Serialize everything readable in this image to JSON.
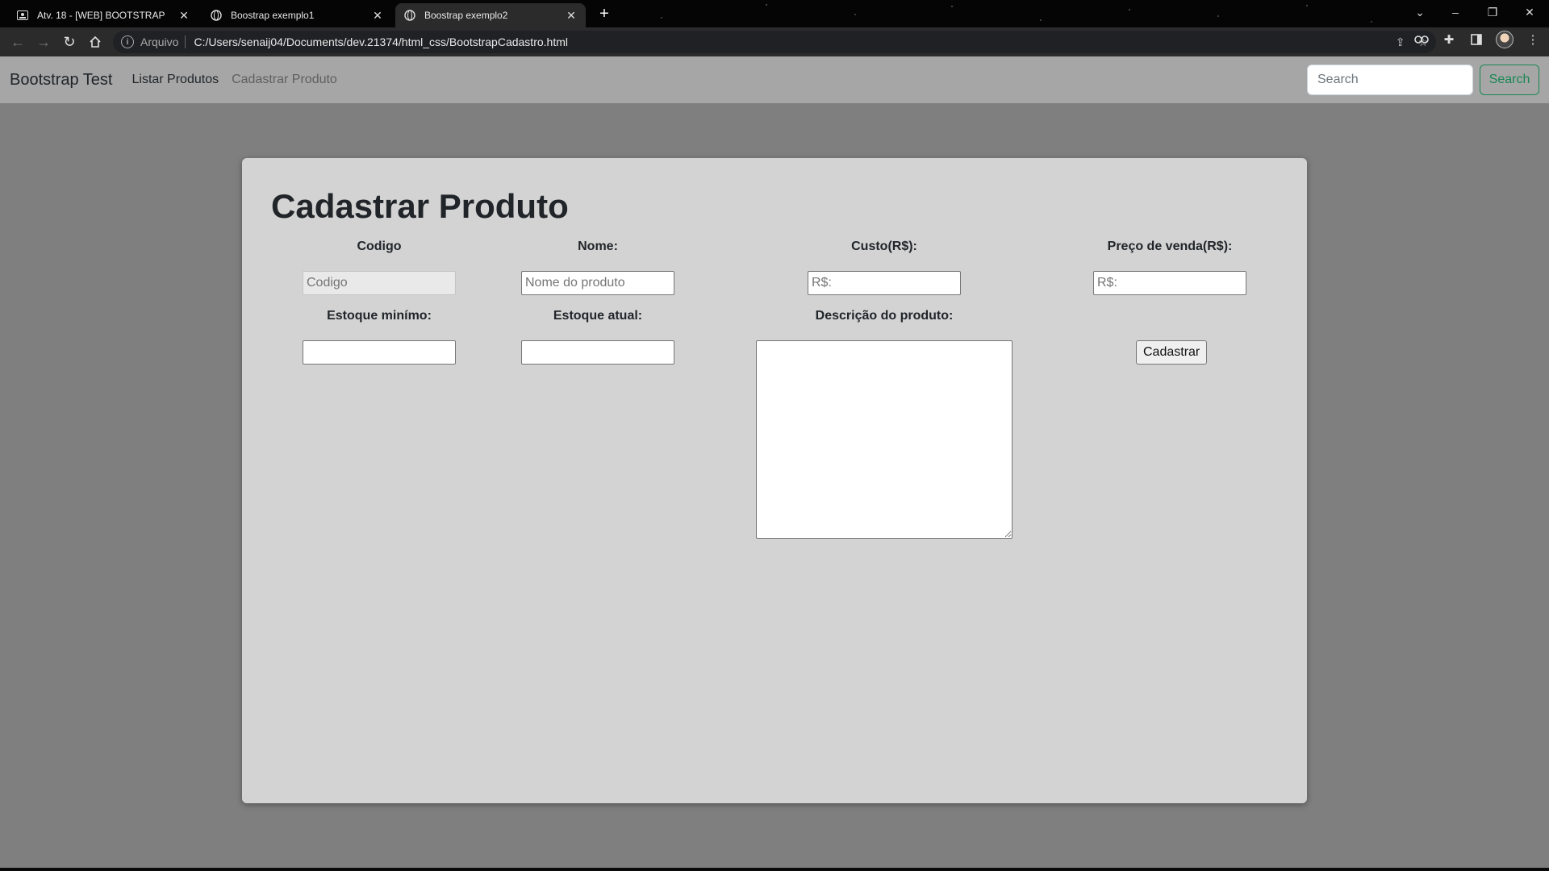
{
  "browser": {
    "tabs": [
      {
        "title": "Atv. 18 - [WEB] BOOTSTRAP",
        "icon": "page-icon",
        "active": false
      },
      {
        "title": "Boostrap exemplo1",
        "icon": "globe-icon",
        "active": false
      },
      {
        "title": "Boostrap exemplo2",
        "icon": "globe-icon",
        "active": true
      }
    ],
    "address": {
      "scheme_label": "Arquivo",
      "url": "C:/Users/senaij04/Documents/dev.21374/html_css/BootstrapCadastro.html"
    }
  },
  "navbar": {
    "brand": "Bootstrap Test",
    "links": [
      "Listar Produtos",
      "Cadastrar Produto"
    ],
    "search_placeholder": "Search",
    "search_button": "Search",
    "accent_color": "#198754"
  },
  "form": {
    "title": "Cadastrar Produto",
    "fields": {
      "codigo": {
        "label": "Codigo",
        "placeholder": "Codigo",
        "value": ""
      },
      "nome": {
        "label": "Nome:",
        "placeholder": "Nome do produto",
        "value": ""
      },
      "custo": {
        "label": "Custo(R$):",
        "placeholder": "R$:",
        "value": ""
      },
      "preco": {
        "label": "Preço de venda(R$):",
        "placeholder": "R$:",
        "value": ""
      },
      "estoque_minimo": {
        "label": "Estoque minímo:",
        "placeholder": "",
        "value": ""
      },
      "estoque_atual": {
        "label": "Estoque atual:",
        "placeholder": "",
        "value": ""
      },
      "descricao": {
        "label": "Descrição do produto:",
        "value": ""
      }
    },
    "submit_label": "Cadastrar"
  }
}
